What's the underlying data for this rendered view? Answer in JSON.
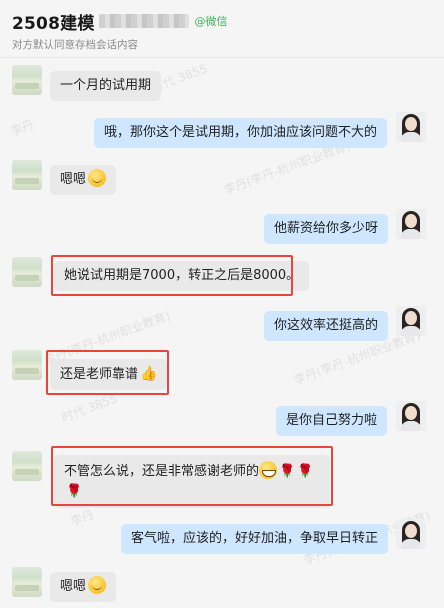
{
  "header": {
    "title": "2508建模",
    "tag": "@微信",
    "subtitle": "对方默认同意存档会话内容"
  },
  "watermark": {
    "lines": [
      "李丹",
      "李丹(李丹-杭州职业教育)",
      "时代 3855"
    ]
  },
  "messages": [
    {
      "side": "in",
      "text": "一个月的试用期"
    },
    {
      "side": "out",
      "text": "哦，那你这个是试用期，你加油应该问题不大的"
    },
    {
      "side": "in",
      "text": "嗯嗯",
      "emoji": "smile"
    },
    {
      "side": "out",
      "text": "他薪资给你多少呀"
    },
    {
      "side": "in",
      "text": "她说试用期是7000，转正之后是8000。",
      "highlighted": true
    },
    {
      "side": "out",
      "text": "你这效率还挺高的"
    },
    {
      "side": "in",
      "text": "还是老师靠谱",
      "emoji": "thumbs-up",
      "highlighted": true
    },
    {
      "side": "out",
      "text": "是你自己努力啦"
    },
    {
      "side": "in",
      "text": "不管怎么说，还是非常感谢老师的",
      "emoji": "grin-roses",
      "highlighted": true
    },
    {
      "side": "out",
      "text": "客气啦，应该的，好好加油，争取早日转正"
    },
    {
      "side": "in",
      "text": "嗯嗯",
      "emoji": "smile"
    }
  ],
  "colors": {
    "outgoing_bubble": "#cfe6ff",
    "incoming_bubble": "#e9e9e9",
    "highlight_border": "#e8453c",
    "wechat_tag": "#3ab35a"
  }
}
